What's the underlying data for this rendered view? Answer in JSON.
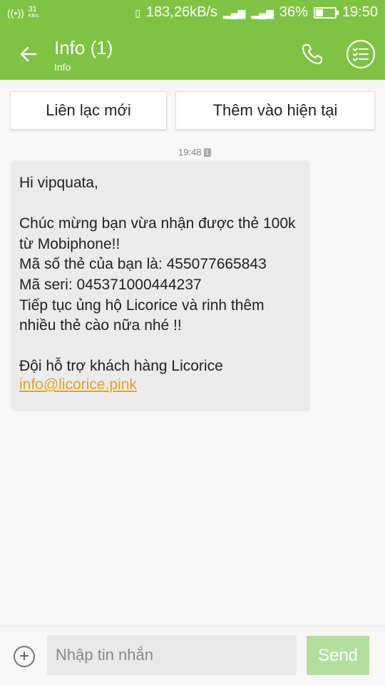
{
  "status_bar": {
    "data_rate_small": "31",
    "data_rate_small_unit": "KB/s",
    "network_speed": "183,26kB/s",
    "battery_percent": "36%",
    "battery_level": 0.36,
    "time": "19:50"
  },
  "app_bar": {
    "title": "Info (1)",
    "subtitle": "Info",
    "icons": [
      "back-arrow-icon",
      "phone-icon",
      "checklist-menu-icon"
    ]
  },
  "actions": {
    "new_contact_label": "Liên lạc mới",
    "add_existing_label": "Thêm vào hiện tại"
  },
  "message": {
    "timestamp": "19:48",
    "sim_label": "1",
    "body": "Hi vipquata,\n\nChúc mừng bạn vừa nhận được thẻ 100k từ Mobiphone!!\nMã số thẻ của bạn là: 455077665843\nMã seri: 045371000444237\nTiếp tục ủng hộ Licorice và rinh thêm nhiều thẻ cào nữa nhé !!\n\nĐội hỗ trợ khách hàng Licorice",
    "email": "info@licorice.pink"
  },
  "compose": {
    "placeholder": "Nhập tin nhắn",
    "send_label": "Send"
  },
  "colors": {
    "accent": "#7fc344",
    "link": "#e8a21c",
    "send_disabled": "#b4dea0"
  }
}
